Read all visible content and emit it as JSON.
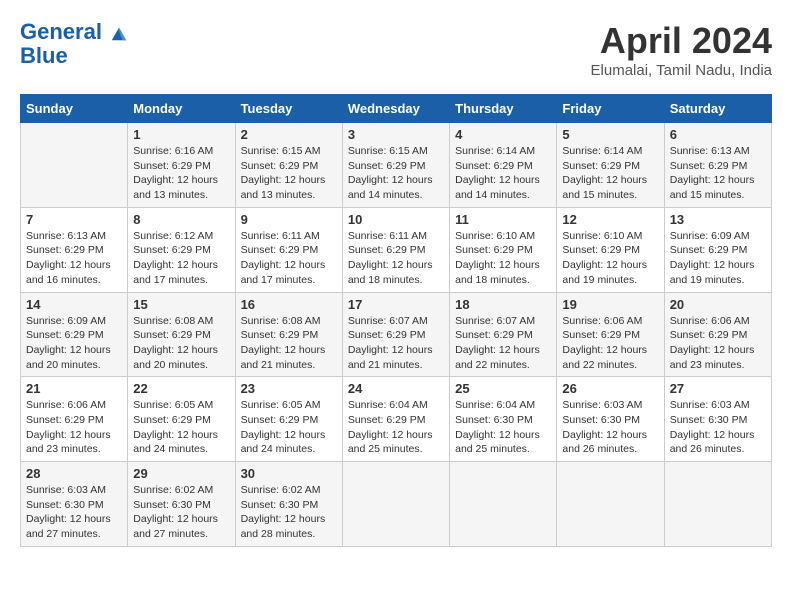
{
  "header": {
    "logo_line1": "General",
    "logo_line2": "Blue",
    "title": "April 2024",
    "subtitle": "Elumalai, Tamil Nadu, India"
  },
  "days_of_week": [
    "Sunday",
    "Monday",
    "Tuesday",
    "Wednesday",
    "Thursday",
    "Friday",
    "Saturday"
  ],
  "weeks": [
    [
      {
        "day": "",
        "info": ""
      },
      {
        "day": "1",
        "info": "Sunrise: 6:16 AM\nSunset: 6:29 PM\nDaylight: 12 hours\nand 13 minutes."
      },
      {
        "day": "2",
        "info": "Sunrise: 6:15 AM\nSunset: 6:29 PM\nDaylight: 12 hours\nand 13 minutes."
      },
      {
        "day": "3",
        "info": "Sunrise: 6:15 AM\nSunset: 6:29 PM\nDaylight: 12 hours\nand 14 minutes."
      },
      {
        "day": "4",
        "info": "Sunrise: 6:14 AM\nSunset: 6:29 PM\nDaylight: 12 hours\nand 14 minutes."
      },
      {
        "day": "5",
        "info": "Sunrise: 6:14 AM\nSunset: 6:29 PM\nDaylight: 12 hours\nand 15 minutes."
      },
      {
        "day": "6",
        "info": "Sunrise: 6:13 AM\nSunset: 6:29 PM\nDaylight: 12 hours\nand 15 minutes."
      }
    ],
    [
      {
        "day": "7",
        "info": "Sunrise: 6:13 AM\nSunset: 6:29 PM\nDaylight: 12 hours\nand 16 minutes."
      },
      {
        "day": "8",
        "info": "Sunrise: 6:12 AM\nSunset: 6:29 PM\nDaylight: 12 hours\nand 17 minutes."
      },
      {
        "day": "9",
        "info": "Sunrise: 6:11 AM\nSunset: 6:29 PM\nDaylight: 12 hours\nand 17 minutes."
      },
      {
        "day": "10",
        "info": "Sunrise: 6:11 AM\nSunset: 6:29 PM\nDaylight: 12 hours\nand 18 minutes."
      },
      {
        "day": "11",
        "info": "Sunrise: 6:10 AM\nSunset: 6:29 PM\nDaylight: 12 hours\nand 18 minutes."
      },
      {
        "day": "12",
        "info": "Sunrise: 6:10 AM\nSunset: 6:29 PM\nDaylight: 12 hours\nand 19 minutes."
      },
      {
        "day": "13",
        "info": "Sunrise: 6:09 AM\nSunset: 6:29 PM\nDaylight: 12 hours\nand 19 minutes."
      }
    ],
    [
      {
        "day": "14",
        "info": "Sunrise: 6:09 AM\nSunset: 6:29 PM\nDaylight: 12 hours\nand 20 minutes."
      },
      {
        "day": "15",
        "info": "Sunrise: 6:08 AM\nSunset: 6:29 PM\nDaylight: 12 hours\nand 20 minutes."
      },
      {
        "day": "16",
        "info": "Sunrise: 6:08 AM\nSunset: 6:29 PM\nDaylight: 12 hours\nand 21 minutes."
      },
      {
        "day": "17",
        "info": "Sunrise: 6:07 AM\nSunset: 6:29 PM\nDaylight: 12 hours\nand 21 minutes."
      },
      {
        "day": "18",
        "info": "Sunrise: 6:07 AM\nSunset: 6:29 PM\nDaylight: 12 hours\nand 22 minutes."
      },
      {
        "day": "19",
        "info": "Sunrise: 6:06 AM\nSunset: 6:29 PM\nDaylight: 12 hours\nand 22 minutes."
      },
      {
        "day": "20",
        "info": "Sunrise: 6:06 AM\nSunset: 6:29 PM\nDaylight: 12 hours\nand 23 minutes."
      }
    ],
    [
      {
        "day": "21",
        "info": "Sunrise: 6:06 AM\nSunset: 6:29 PM\nDaylight: 12 hours\nand 23 minutes."
      },
      {
        "day": "22",
        "info": "Sunrise: 6:05 AM\nSunset: 6:29 PM\nDaylight: 12 hours\nand 24 minutes."
      },
      {
        "day": "23",
        "info": "Sunrise: 6:05 AM\nSunset: 6:29 PM\nDaylight: 12 hours\nand 24 minutes."
      },
      {
        "day": "24",
        "info": "Sunrise: 6:04 AM\nSunset: 6:29 PM\nDaylight: 12 hours\nand 25 minutes."
      },
      {
        "day": "25",
        "info": "Sunrise: 6:04 AM\nSunset: 6:30 PM\nDaylight: 12 hours\nand 25 minutes."
      },
      {
        "day": "26",
        "info": "Sunrise: 6:03 AM\nSunset: 6:30 PM\nDaylight: 12 hours\nand 26 minutes."
      },
      {
        "day": "27",
        "info": "Sunrise: 6:03 AM\nSunset: 6:30 PM\nDaylight: 12 hours\nand 26 minutes."
      }
    ],
    [
      {
        "day": "28",
        "info": "Sunrise: 6:03 AM\nSunset: 6:30 PM\nDaylight: 12 hours\nand 27 minutes."
      },
      {
        "day": "29",
        "info": "Sunrise: 6:02 AM\nSunset: 6:30 PM\nDaylight: 12 hours\nand 27 minutes."
      },
      {
        "day": "30",
        "info": "Sunrise: 6:02 AM\nSunset: 6:30 PM\nDaylight: 12 hours\nand 28 minutes."
      },
      {
        "day": "",
        "info": ""
      },
      {
        "day": "",
        "info": ""
      },
      {
        "day": "",
        "info": ""
      },
      {
        "day": "",
        "info": ""
      }
    ]
  ]
}
